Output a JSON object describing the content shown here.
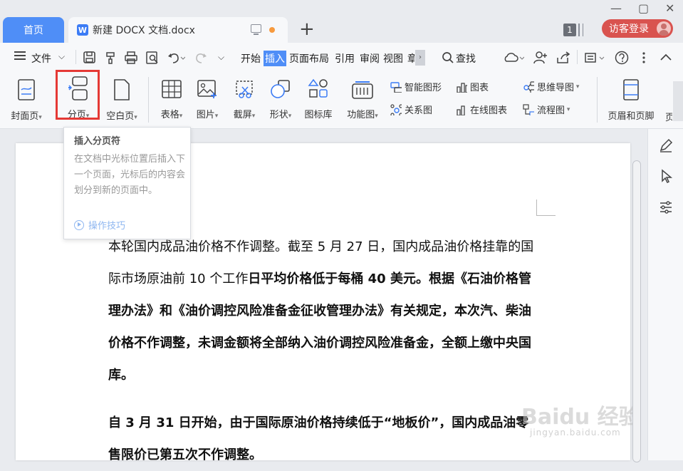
{
  "tabs": {
    "home_label": "首页",
    "doc_title": "新建 DOCX 文档.docx",
    "doc_icon_letter": "W",
    "add_tab": "+"
  },
  "window": {
    "minimize": "—",
    "maximize": "▢",
    "close": "✕"
  },
  "account": {
    "window_count": "1",
    "login_label": "访客登录"
  },
  "menu": {
    "file_label": "文件",
    "items": [
      "开始",
      "插入",
      "页面布局",
      "引用",
      "审阅",
      "视图",
      "章"
    ],
    "active_item": "插入",
    "search_label": "查找"
  },
  "ribbon": {
    "cover_page": "封面页",
    "page_break": "分页",
    "blank_page": "空白页",
    "table": "表格",
    "picture": "图片",
    "screenshot": "截屏",
    "shape": "形状",
    "icon_library": "图标库",
    "function_chart": "功能图",
    "smart_art": "智能图形",
    "chart": "图表",
    "relation_chart": "关系图",
    "online_chart": "在线图表",
    "mind_map": "思维导图",
    "flowchart": "流程图",
    "header_footer": "页眉和页脚",
    "more_cut": "页"
  },
  "tooltip": {
    "title": "插入分页符",
    "body": "在文档中光标位置后插入下一个页面，光标后的内容会划分到新的页面中。",
    "tip_link": "操作技巧"
  },
  "document": {
    "p1_normal": "本轮国内成品油价格不作调整。截至 5 月 27 日，国内成品油价格挂靠的国际市场原油前 10 个工作",
    "p1_bold": "日平均价格低于每桶 40 美元。根据《石油价格管理办法》和《油价调控风险准备金征收管理办法》有关规定，本次汽、柴油价格不作调整，未调金额将全部纳入油价调控风险准备金，全额上缴中央国库。",
    "p2_bold": "自 3 月 31 日开始，由于国际原油价格持续低于“地板价”，国内成品油零售限价已第五次不作调整。"
  },
  "watermark": {
    "main": "Baidu 经验",
    "sub": "jingyan.baidu.com"
  }
}
